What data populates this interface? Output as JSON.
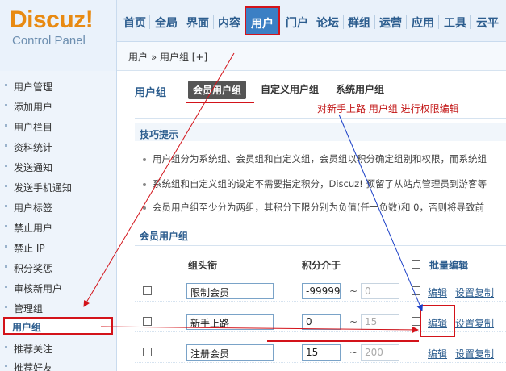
{
  "logo": {
    "main": "Discuz!",
    "sub": "Control Panel"
  },
  "topnav": {
    "items": [
      "首页",
      "全局",
      "界面",
      "内容",
      "用户",
      "门户",
      "论坛",
      "群组",
      "运营",
      "应用",
      "工具",
      "云平"
    ],
    "active": "用户"
  },
  "breadcrumb": "用户 » 用户组  [+]",
  "sidebar": {
    "items": [
      "用户管理",
      "添加用户",
      "用户栏目",
      "资料统计",
      "发送通知",
      "发送手机通知",
      "用户标签",
      "禁止用户",
      "禁止 IP",
      "积分奖惩",
      "审核新用户",
      "管理组",
      "用户组",
      "推荐关注",
      "推荐好友"
    ],
    "active": "用户组"
  },
  "main": {
    "title": "用户组",
    "tabs": [
      "会员用户组",
      "自定义用户组",
      "系统用户组"
    ],
    "active_tab": "会员用户组",
    "annotation": "对新手上路 用户组 进行权限编辑",
    "tips": {
      "title": "技巧提示",
      "items": [
        "用户组分为系统组、会员组和自定义组，会员组以积分确定组别和权限，而系统组",
        "系统组和自定义组的设定不需要指定积分，Discuz! 预留了从站点管理员到游客等",
        "会员用户组至少分为两组，其积分下限分别为负值(任一负数)和 0，否则将导致前"
      ]
    },
    "group_section_title": "会员用户组",
    "columns": {
      "title": "组头衔",
      "credits": "积分介于",
      "batch": "批量编辑"
    },
    "rows": [
      {
        "name": "限制会员",
        "min": "-99999",
        "max": "0",
        "edit": "编辑",
        "copy": "设置复制"
      },
      {
        "name": "新手上路",
        "min": "0",
        "max": "15",
        "edit": "编辑",
        "copy": "设置复制"
      },
      {
        "name": "注册会员",
        "min": "15",
        "max": "200",
        "edit": "编辑",
        "copy": "设置复制"
      }
    ]
  },
  "colors": {
    "accent": "#2c5d8e",
    "highlight": "#d3131a",
    "nav_active": "#3b7fc4",
    "logo": "#e88a12"
  }
}
